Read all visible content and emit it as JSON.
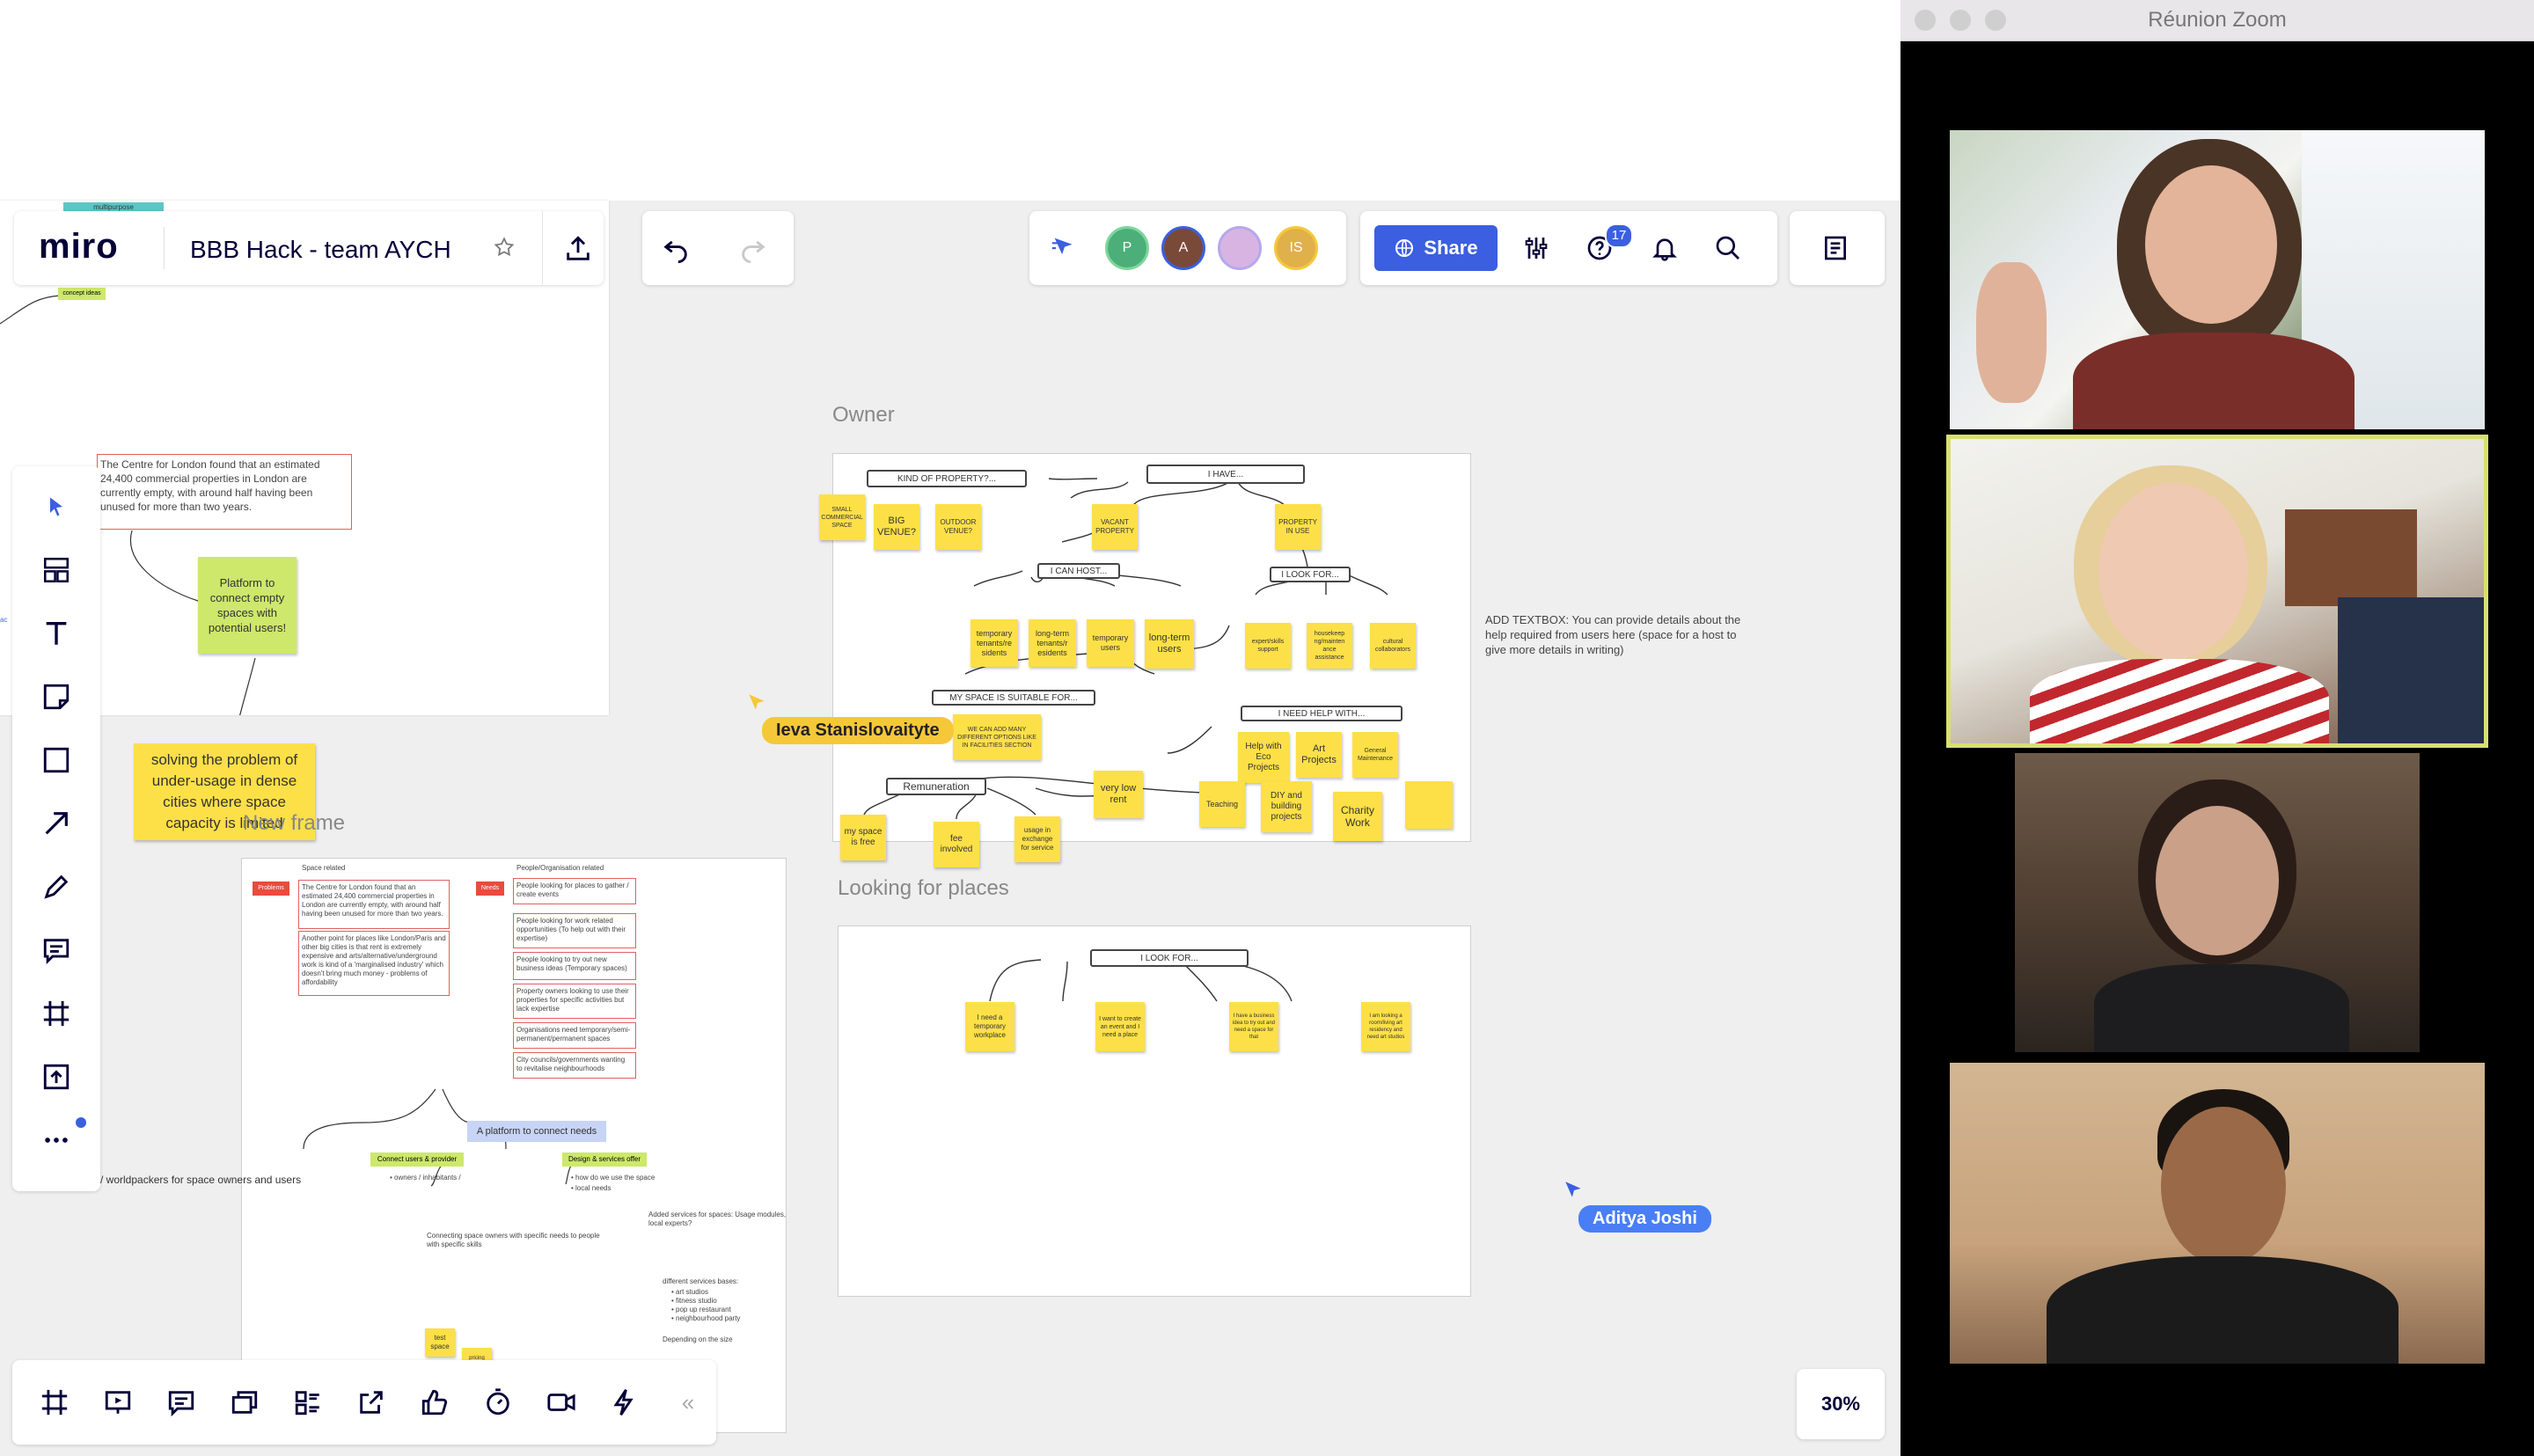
{
  "app": {
    "logo": "miro",
    "board_title": "BBB Hack - team AYCH",
    "tag_label": "multipurpose"
  },
  "toolbar": {
    "share_label": "Share",
    "notifications_count": "17",
    "collaborators": [
      {
        "initial": "P",
        "color": "#4caf7a"
      },
      {
        "initial": "A",
        "color": "#7a4a38"
      },
      {
        "initial": "",
        "color": "#d8b4e2"
      },
      {
        "initial": "IS",
        "color": "#e0b04a"
      }
    ],
    "zoom_level": "30%"
  },
  "left_tools": [
    "select-icon",
    "templates-icon",
    "text-icon",
    "sticky-note-icon",
    "shape-icon",
    "arrow-icon",
    "pen-icon",
    "comment-icon",
    "frame-icon",
    "upload-icon",
    "more-icon"
  ],
  "bottom_tools": [
    "frames-icon",
    "presentation-icon",
    "comments-icon",
    "cards-icon",
    "board-list-icon",
    "screen-share-icon",
    "vote-icon",
    "timer-icon",
    "video-chat-icon",
    "lightning-icon",
    "collapse-icon"
  ],
  "canvas": {
    "frame_labels": {
      "owner": "Owner",
      "looking": "Looking for places",
      "new_frame": "New frame"
    },
    "first_frame": {
      "concept_tag": "concept ideas",
      "centre_text": "The Centre for London found that an estimated 24,400 commercial properties in London are currently empty, with around half having been unused for more than two years.",
      "platform_note": "Platform to connect empty spaces with potential users!",
      "solving_note": "solving the problem of under-usage in dense cities where space capacity is limited"
    },
    "owner_frame": {
      "kind_box": "KIND OF PROPERTY?...",
      "i_have_box": "I HAVE...",
      "i_can_host_box": "I CAN HOST...",
      "i_look_for_box": "I LOOK FOR...",
      "suitable_box": "MY SPACE IS SUITABLE FOR...",
      "need_help_box": "I NEED HELP WITH...",
      "remuneration_box": "Remuneration",
      "stickies": {
        "small_space": "SMALL COMMERCIAL SPACE",
        "big_venue": "BIG VENUE?",
        "outdoor_venue": "OUTDOOR VENUE?",
        "vacant_property": "VACANT PROPERTY",
        "property_in_use": "PROPERTY IN USE",
        "temp_tenants": "temporary tenants/re sidents",
        "long_term_tenants": "long-term tenants/r esidents",
        "temp_users": "temporary users",
        "long_term_users": "long-term users",
        "expert_skills": "expert/skills support",
        "housekeeping": "housekeep ng/mainten ance assistance",
        "cultural": "cultural collaborators",
        "we_can_add": "WE CAN ADD MANY DIFFERENT OPTIONS LIKE IN FACILITIES SECTION",
        "eco_projects": "Help with Eco Projects",
        "art_projects": "Art Projects",
        "general_maintenance": "General Maintenance",
        "teaching": "Teaching",
        "diy": "DIY and building projects",
        "charity": "Charity Work",
        "very_low_rent": "very low rent",
        "space_free": "my space is free",
        "fee_involved": "fee involved",
        "usage_exchange": "usage in exchange for service"
      }
    },
    "textbox_note": "ADD TEXTBOX: You can provide details about the help required from users here (space for a host to give more details in writing)",
    "looking_frame": {
      "i_look_for_box": "I LOOK FOR...",
      "stickies": {
        "temp_workplace": "I need a temporary workplace",
        "create_event": "I want to create an event and I need a place",
        "business_idea": "I have a business idea to try out and need a space for that",
        "residency": "I am looking a room/living art residency and need art studios"
      }
    },
    "new_frame": {
      "space_related": "Space related",
      "people_related": "People/Organisation related",
      "problems_tag": "Problems",
      "needs_tag": "Needs",
      "problem_1": "The Centre for London found that an estimated 24,400 commercial properties in London are currently empty, with around half having been unused for more than two years.",
      "problem_2": "Another point for places like London/Paris and other big cities is that rent is extremely expensive and arts/alternative/underground work is kind of a 'marginalised industry' which doesn't bring much money - problems of affordability",
      "need_1": "People looking for places to gather / create events",
      "need_2": "People looking for work related opportunities (To help out with their expertise)",
      "need_3": "People looking to try out new business ideas (Temporary spaces)",
      "need_4": "Property owners looking to use their properties for specific activities but lack expertise",
      "need_5": "Organisations need temporary/semi-permanent/permanent spaces",
      "need_6": "City councils/governments wanting to revitalise neighbourhoods",
      "platform_label": "A platform to connect needs",
      "connect_tag": "Connect users & provider",
      "design_tag": "Design & services offer",
      "owners_text": "owners / inhabitants /",
      "use_space_text": "how do we use the space",
      "local_needs_text": "local needs",
      "worldpackers_text": "/ worldpackers for space owners and users",
      "added_services_text": "Added services for spaces: Usage modules, local experts?",
      "connecting_text": "Connecting space owners with specific needs to people with specific skills",
      "services_bases": "different services bases:",
      "service_list": [
        "art studios",
        "fitness studio",
        "pop up restaurant",
        "neighbourhood party"
      ],
      "depending": "Depending on the size",
      "test_space": "test space",
      "pricing_note": "pricing offer"
    },
    "cursors": {
      "ieva": "Ieva Stanislovaityte",
      "aditya": "Aditya Joshi"
    }
  },
  "zoom": {
    "window_title": "Réunion Zoom"
  }
}
